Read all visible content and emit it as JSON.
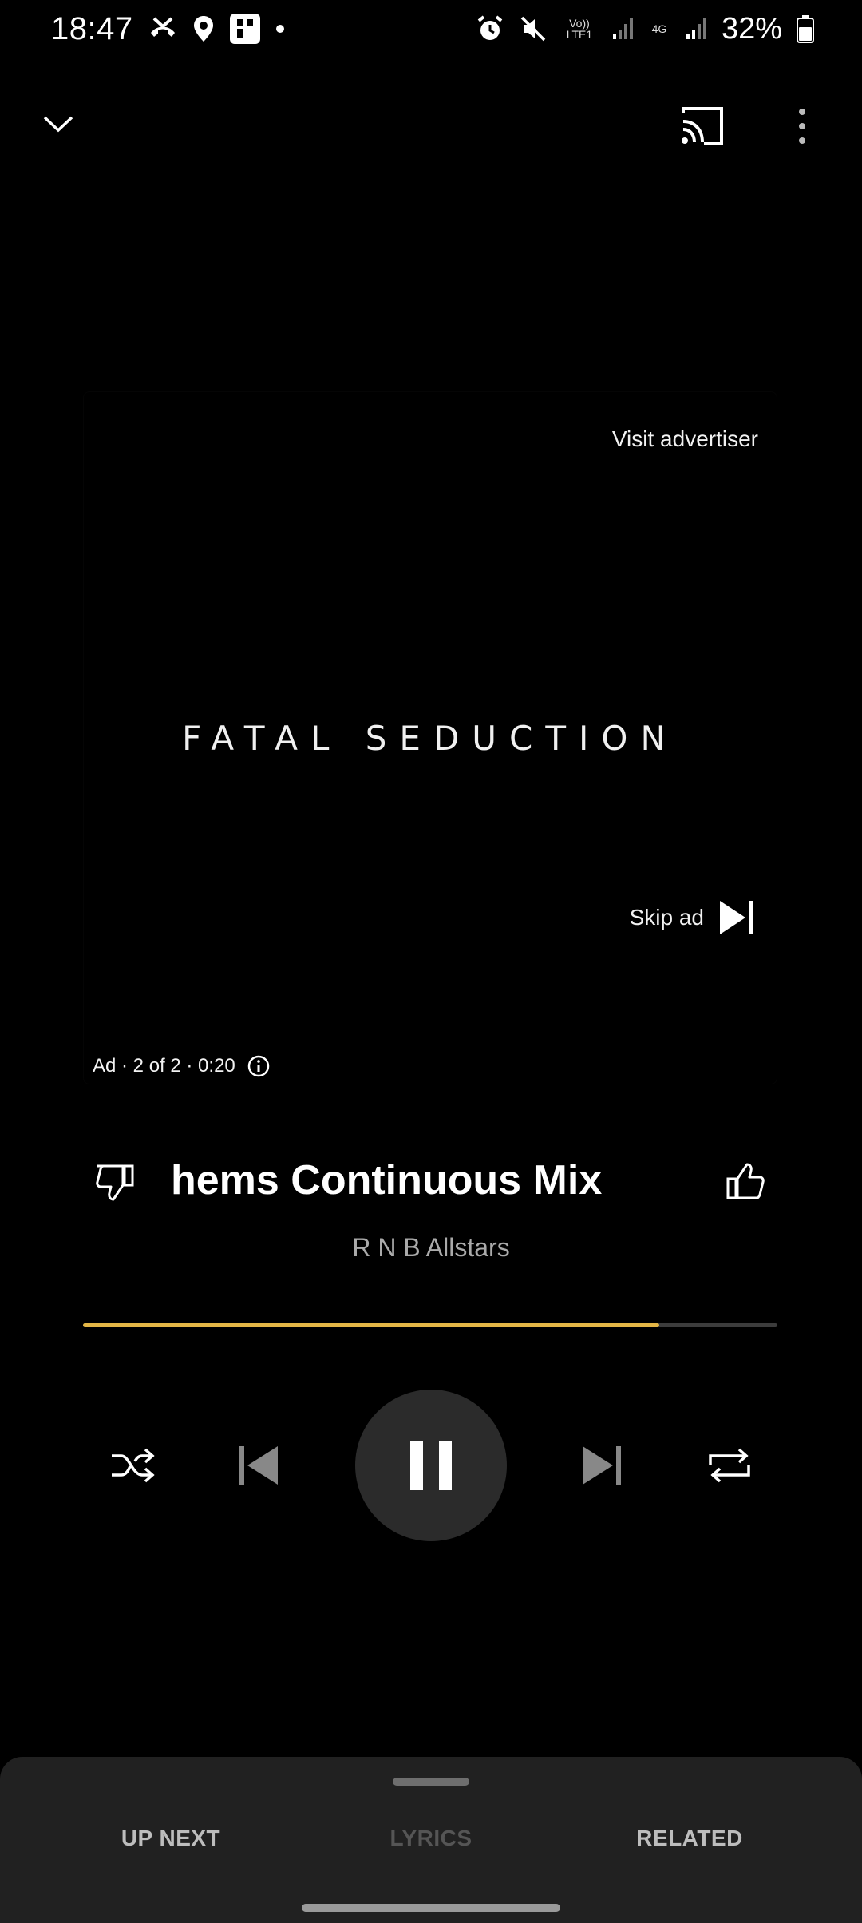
{
  "status_bar": {
    "time": "18:47",
    "battery": "32%",
    "network_label": "4G",
    "volte_label": "Vo)) LTE1"
  },
  "ad": {
    "visit_label": "Visit advertiser",
    "title": "FATAL SEDUCTION",
    "skip_label": "Skip ad",
    "info": "Ad · 2 of 2 · 0:20"
  },
  "song": {
    "title": "hems Continuous Mix",
    "artist": "R N B Allstars"
  },
  "progress": {
    "fraction": 0.83,
    "color": "#e3b646"
  },
  "tabs": {
    "up_next": "UP NEXT",
    "lyrics": "LYRICS",
    "related": "RELATED"
  }
}
